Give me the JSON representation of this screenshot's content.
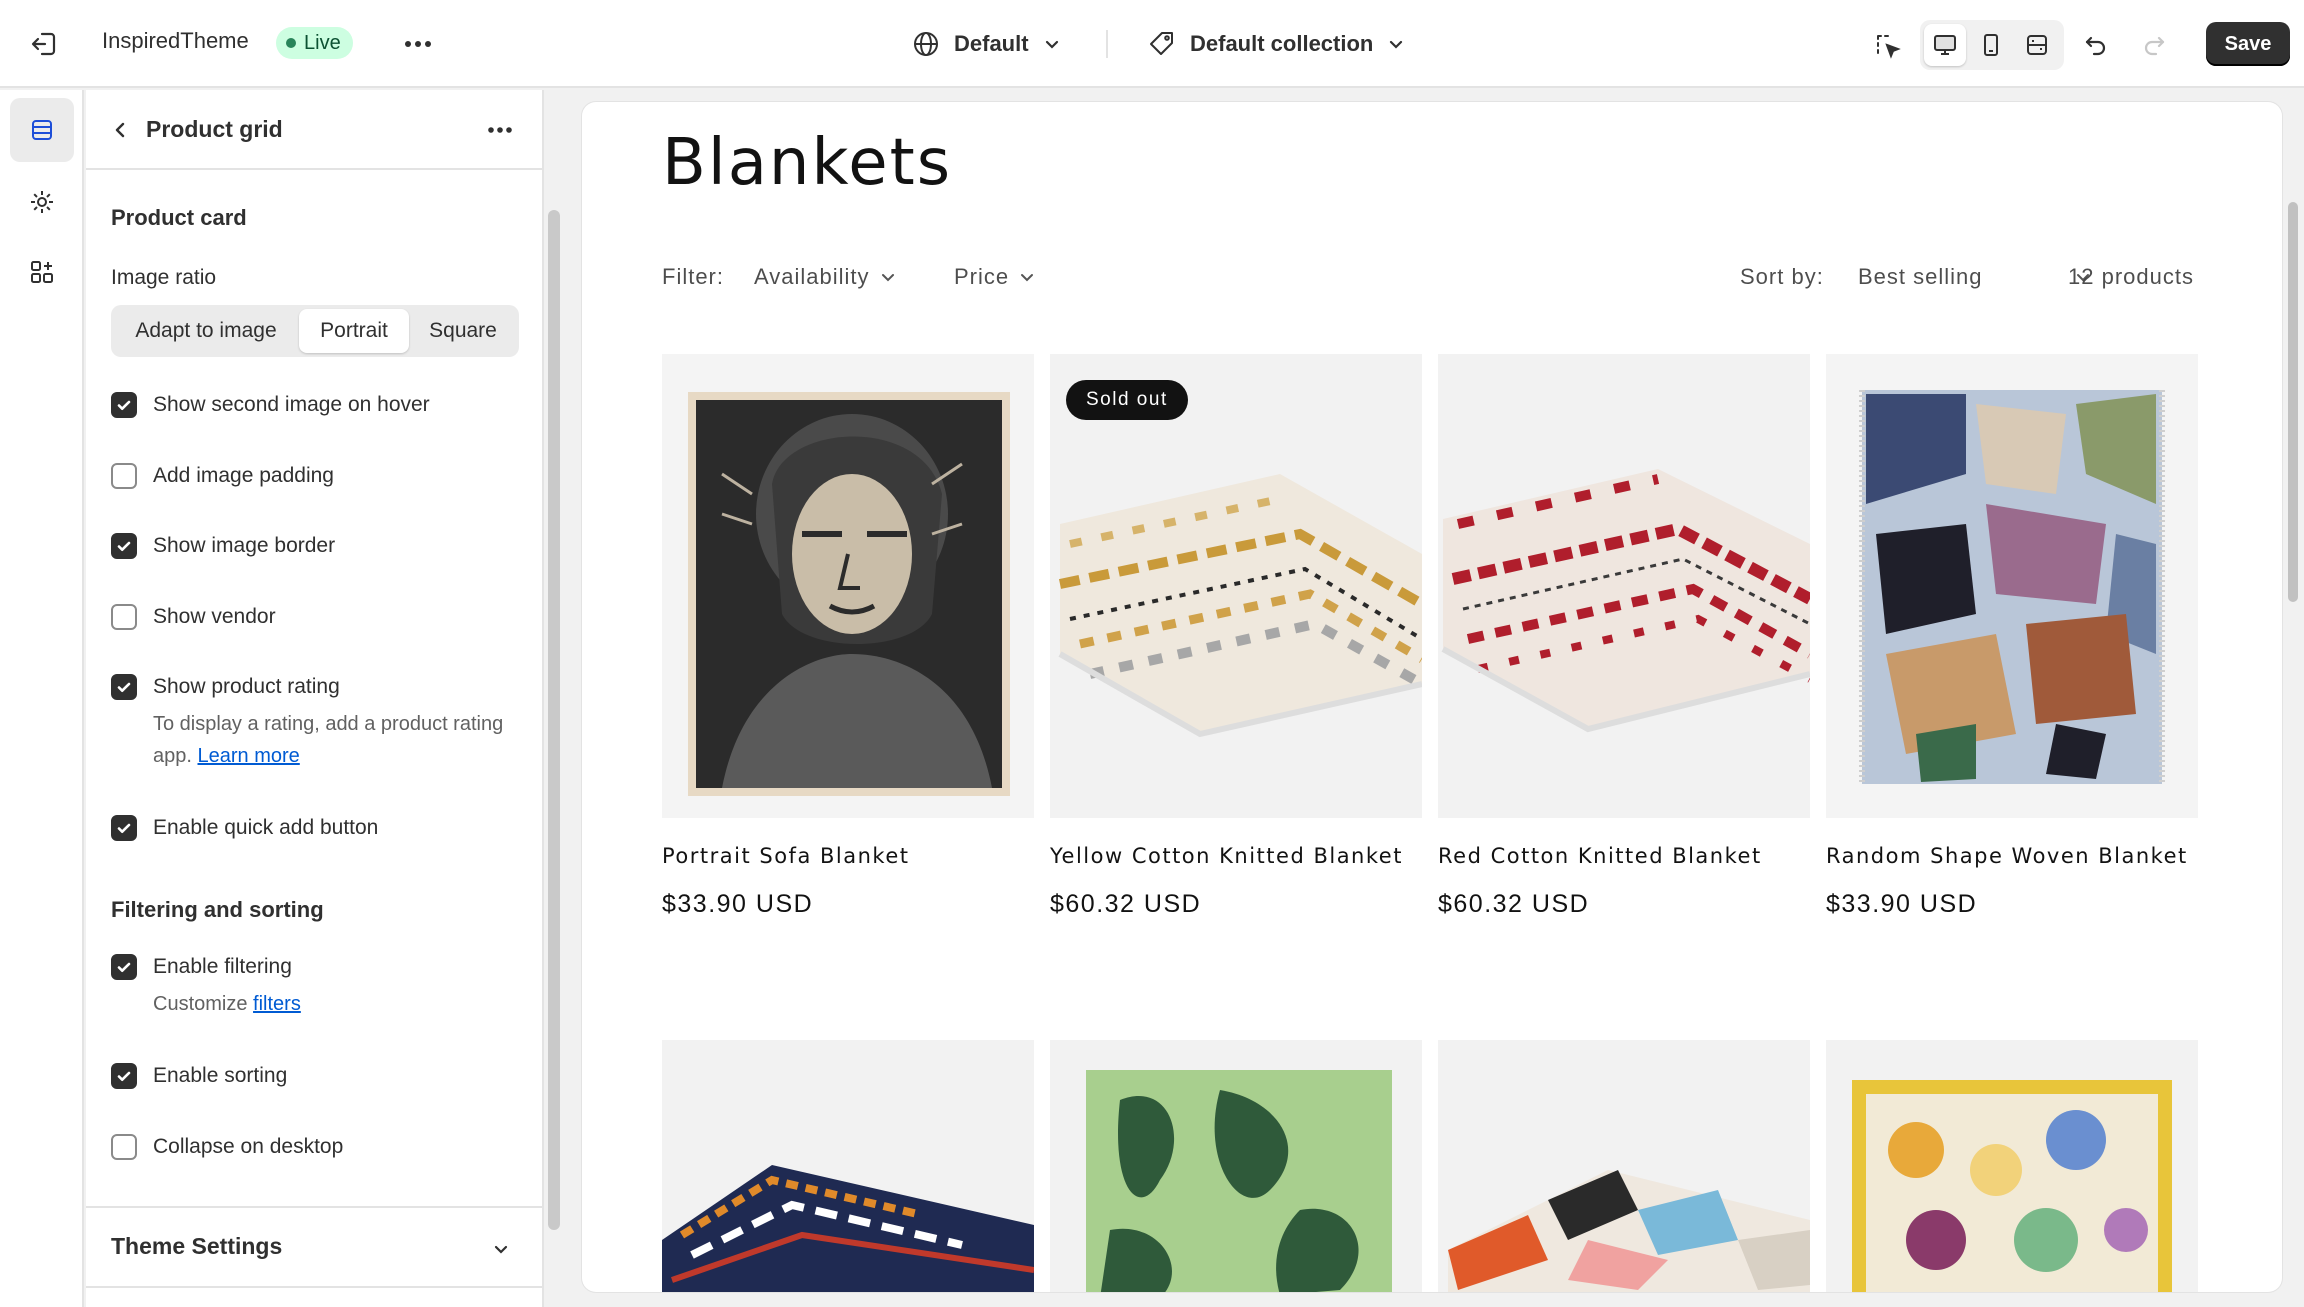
{
  "topbar": {
    "theme_name": "InspiredTheme",
    "status": "Live",
    "locale": "Default",
    "template": "Default collection",
    "save_label": "Save"
  },
  "panel": {
    "title": "Product grid",
    "product_card": {
      "heading": "Product card",
      "image_ratio_label": "Image ratio",
      "image_ratio_options": [
        "Adapt to image",
        "Portrait",
        "Square"
      ],
      "image_ratio_selected": "Portrait",
      "show_second_image": {
        "label": "Show second image on hover",
        "checked": true
      },
      "add_image_padding": {
        "label": "Add image padding",
        "checked": false
      },
      "show_image_border": {
        "label": "Show image border",
        "checked": true
      },
      "show_vendor": {
        "label": "Show vendor",
        "checked": false
      },
      "show_product_rating": {
        "label": "Show product rating",
        "checked": true,
        "help_text": "To display a rating, add a product rating app.",
        "help_link": "Learn more"
      },
      "enable_quick_add": {
        "label": "Enable quick add button",
        "checked": true
      }
    },
    "filtering": {
      "heading": "Filtering and sorting",
      "enable_filtering": {
        "label": "Enable filtering",
        "checked": true,
        "help_text": "Customize",
        "help_link": "filters"
      },
      "enable_sorting": {
        "label": "Enable sorting",
        "checked": true
      },
      "collapse_on_desktop": {
        "label": "Collapse on desktop",
        "checked": false
      }
    },
    "theme_settings": "Theme Settings"
  },
  "preview": {
    "collection_title": "Blankets",
    "filter_label": "Filter:",
    "filter_availability": "Availability",
    "filter_price": "Price",
    "sort_label": "Sort by:",
    "sort_value": "Best selling",
    "product_count": "12 products",
    "sold_out_badge": "Sold out",
    "products": [
      {
        "title": "Portrait Sofa Blanket",
        "price": "$33.90 USD"
      },
      {
        "title": "Yellow Cotton Knitted Blanket",
        "price": "$60.32 USD"
      },
      {
        "title": "Red Cotton Knitted Blanket",
        "price": "$60.32 USD"
      },
      {
        "title": "Random Shape Woven Blanket",
        "price": "$33.90 USD"
      }
    ]
  },
  "colors": {
    "accent_link": "#005bd3",
    "live_badge_bg": "#cdfee1",
    "live_dot": "#29845a",
    "save_bg": "#303030"
  },
  "icons": {
    "exit": "exit-icon",
    "more": "more-horizontal-icon",
    "globe": "globe-icon",
    "template": "tag-icon",
    "inspector": "inspector-icon",
    "desktop": "desktop-icon",
    "mobile": "mobile-icon",
    "fullwidth": "fullscreen-icon",
    "undo": "undo-icon",
    "redo": "redo-icon",
    "sections": "sections-icon",
    "settings": "gear-icon",
    "apps": "apps-icon"
  }
}
